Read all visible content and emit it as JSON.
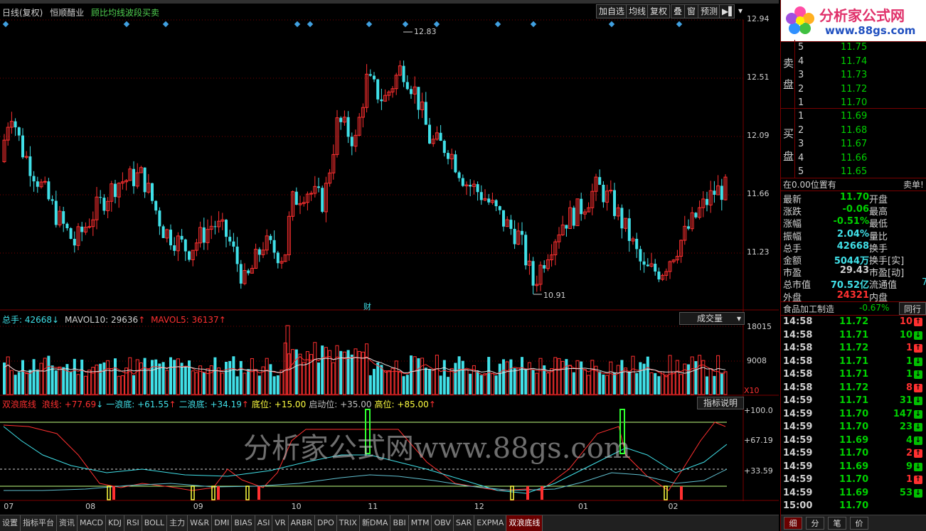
{
  "header": {
    "period_label": "日线(复权)",
    "stock_name": "恒顺醋业",
    "indicator_name": "顾比均线波段买卖",
    "buttons": [
      "加自选",
      "均线",
      "复权",
      "叠",
      "窗",
      "预测"
    ]
  },
  "price_axis": [
    "12.94",
    "12.51",
    "12.09",
    "11.66",
    "11.23"
  ],
  "annotations": {
    "high": "12.83",
    "low": "10.91",
    "marker": "财"
  },
  "volume_header": {
    "prefix": "总手: ",
    "zongshou": "42668",
    "mavol10_label": "MAVOL10: ",
    "mavol10": "29636",
    "mavol5_label": "MAVOL5: ",
    "mavol5": "36137",
    "dropdown": "成交量"
  },
  "volume_axis": [
    "18015",
    "9008"
  ],
  "volume_unit": "X10",
  "ind_header": {
    "name": "双浪底线",
    "items": [
      {
        "label": "浪线:",
        "value": "+77.69",
        "dir": "↓",
        "color": "#ff3030"
      },
      {
        "label": "一浪底:",
        "value": "+61.55",
        "dir": "↑",
        "color": "#40e0e8"
      },
      {
        "label": "二浪底:",
        "value": "+34.19",
        "dir": "↑",
        "color": "#40e0e8"
      },
      {
        "label": "底位:",
        "value": "+15.00",
        "dir": "",
        "color": "#ffff40"
      },
      {
        "label": "启动位:",
        "value": "+35.00",
        "dir": "",
        "color": "#c0c0c0"
      },
      {
        "label": "高位:",
        "value": "+85.00",
        "dir": "↑",
        "color": "#ffff40"
      }
    ],
    "help_button": "指标说明"
  },
  "ind_axis": [
    "+100.0",
    "+67.19",
    "+33.59"
  ],
  "watermark": "分析家公式网www.88gs.com",
  "x_axis": [
    {
      "label": "07",
      "pos": 0.005
    },
    {
      "label": "08",
      "pos": 0.115
    },
    {
      "label": "09",
      "pos": 0.26
    },
    {
      "label": "10",
      "pos": 0.392
    },
    {
      "label": "11",
      "pos": 0.495
    },
    {
      "label": "12",
      "pos": 0.638
    },
    {
      "label": "01",
      "pos": 0.778
    },
    {
      "label": "02",
      "pos": 0.899
    }
  ],
  "tabs": [
    "设置",
    "指标平台",
    "资讯",
    "MACD",
    "KDJ",
    "RSI",
    "BOLL",
    "主力",
    "W&R",
    "DMI",
    "BIAS",
    "ASI",
    "VR",
    "ARBR",
    "DPO",
    "TRIX",
    "新DMA",
    "BBI",
    "MTM",
    "OBV",
    "SAR",
    "EXPMA",
    "双浪底线"
  ],
  "active_tab": "双浪底线",
  "logo": {
    "title": "分析家公式网",
    "url": "www.88gs.com"
  },
  "order_book": {
    "sell_label": [
      "卖",
      "盘"
    ],
    "buy_label": [
      "买",
      "盘"
    ],
    "sells": [
      {
        "n": "5",
        "p": "11.75"
      },
      {
        "n": "4",
        "p": "11.74"
      },
      {
        "n": "3",
        "p": "11.73"
      },
      {
        "n": "2",
        "p": "11.72"
      },
      {
        "n": "1",
        "p": "11.70"
      }
    ],
    "buys": [
      {
        "n": "1",
        "p": "11.69"
      },
      {
        "n": "2",
        "p": "11.68"
      },
      {
        "n": "3",
        "p": "11.67"
      },
      {
        "n": "4",
        "p": "11.66"
      },
      {
        "n": "5",
        "p": "11.65"
      }
    ]
  },
  "position_row": {
    "left": "在0.00位置有",
    "right": "卖单!"
  },
  "quote": [
    {
      "label": "最新",
      "value": "11.70",
      "vcls": "c-dn",
      "label2": "开盘",
      "value2": ""
    },
    {
      "label": "涨跌",
      "value": "-0.06",
      "vcls": "c-dn",
      "label2": "最高",
      "value2": ""
    },
    {
      "label": "涨幅",
      "value": "-0.51%",
      "vcls": "c-dn",
      "label2": "最低",
      "value2": ""
    },
    {
      "label": "振幅",
      "value": "2.04%",
      "vcls": "c-cy",
      "label2": "量比",
      "value2": ""
    },
    {
      "label": "总手",
      "value": "42668",
      "vcls": "c-cy",
      "label2": "换手",
      "value2": ""
    },
    {
      "label": "金额",
      "value": "5044万",
      "vcls": "c-cy",
      "label2": "换手[实]",
      "value2": ""
    },
    {
      "label": "市盈",
      "value": "29.43",
      "vcls": "c-w",
      "label2": "市盈[动]",
      "value2": ""
    },
    {
      "label": "总市值",
      "value": "70.52亿",
      "vcls": "c-cy",
      "label2": "流通值",
      "value2": "7"
    },
    {
      "label": "外盘",
      "value": "24321",
      "vcls": "c-up",
      "label2": "内盘",
      "value2": ""
    }
  ],
  "industry": {
    "name": "食品加工制造",
    "change": "-0.67%",
    "button": "同行"
  },
  "ticks": [
    {
      "t": "14:58",
      "p": "11.72",
      "v": "10",
      "d": "up"
    },
    {
      "t": "14:58",
      "p": "11.71",
      "v": "10",
      "d": "dn"
    },
    {
      "t": "14:58",
      "p": "11.72",
      "v": "1",
      "d": "up"
    },
    {
      "t": "14:58",
      "p": "11.71",
      "v": "1",
      "d": "dn"
    },
    {
      "t": "14:58",
      "p": "11.71",
      "v": "1",
      "d": "dn"
    },
    {
      "t": "14:58",
      "p": "11.72",
      "v": "8",
      "d": "up"
    },
    {
      "t": "14:59",
      "p": "11.71",
      "v": "31",
      "d": "dn"
    },
    {
      "t": "14:59",
      "p": "11.70",
      "v": "147",
      "d": "dn"
    },
    {
      "t": "14:59",
      "p": "11.70",
      "v": "23",
      "d": "dn"
    },
    {
      "t": "14:59",
      "p": "11.69",
      "v": "4",
      "d": "dn"
    },
    {
      "t": "14:59",
      "p": "11.70",
      "v": "2",
      "d": "up"
    },
    {
      "t": "14:59",
      "p": "11.69",
      "v": "9",
      "d": "dn"
    },
    {
      "t": "14:59",
      "p": "11.70",
      "v": "1",
      "d": "up"
    },
    {
      "t": "14:59",
      "p": "11.69",
      "v": "53",
      "d": "dn"
    },
    {
      "t": "15:00",
      "p": "11.70",
      "v": "",
      "d": ""
    }
  ],
  "bottom_tabs": [
    "细",
    "分",
    "笔",
    "价"
  ],
  "colors": {
    "up": "#ff3030",
    "down": "#40e0e8",
    "grid": "#7a0000",
    "bg": "#000000"
  }
}
